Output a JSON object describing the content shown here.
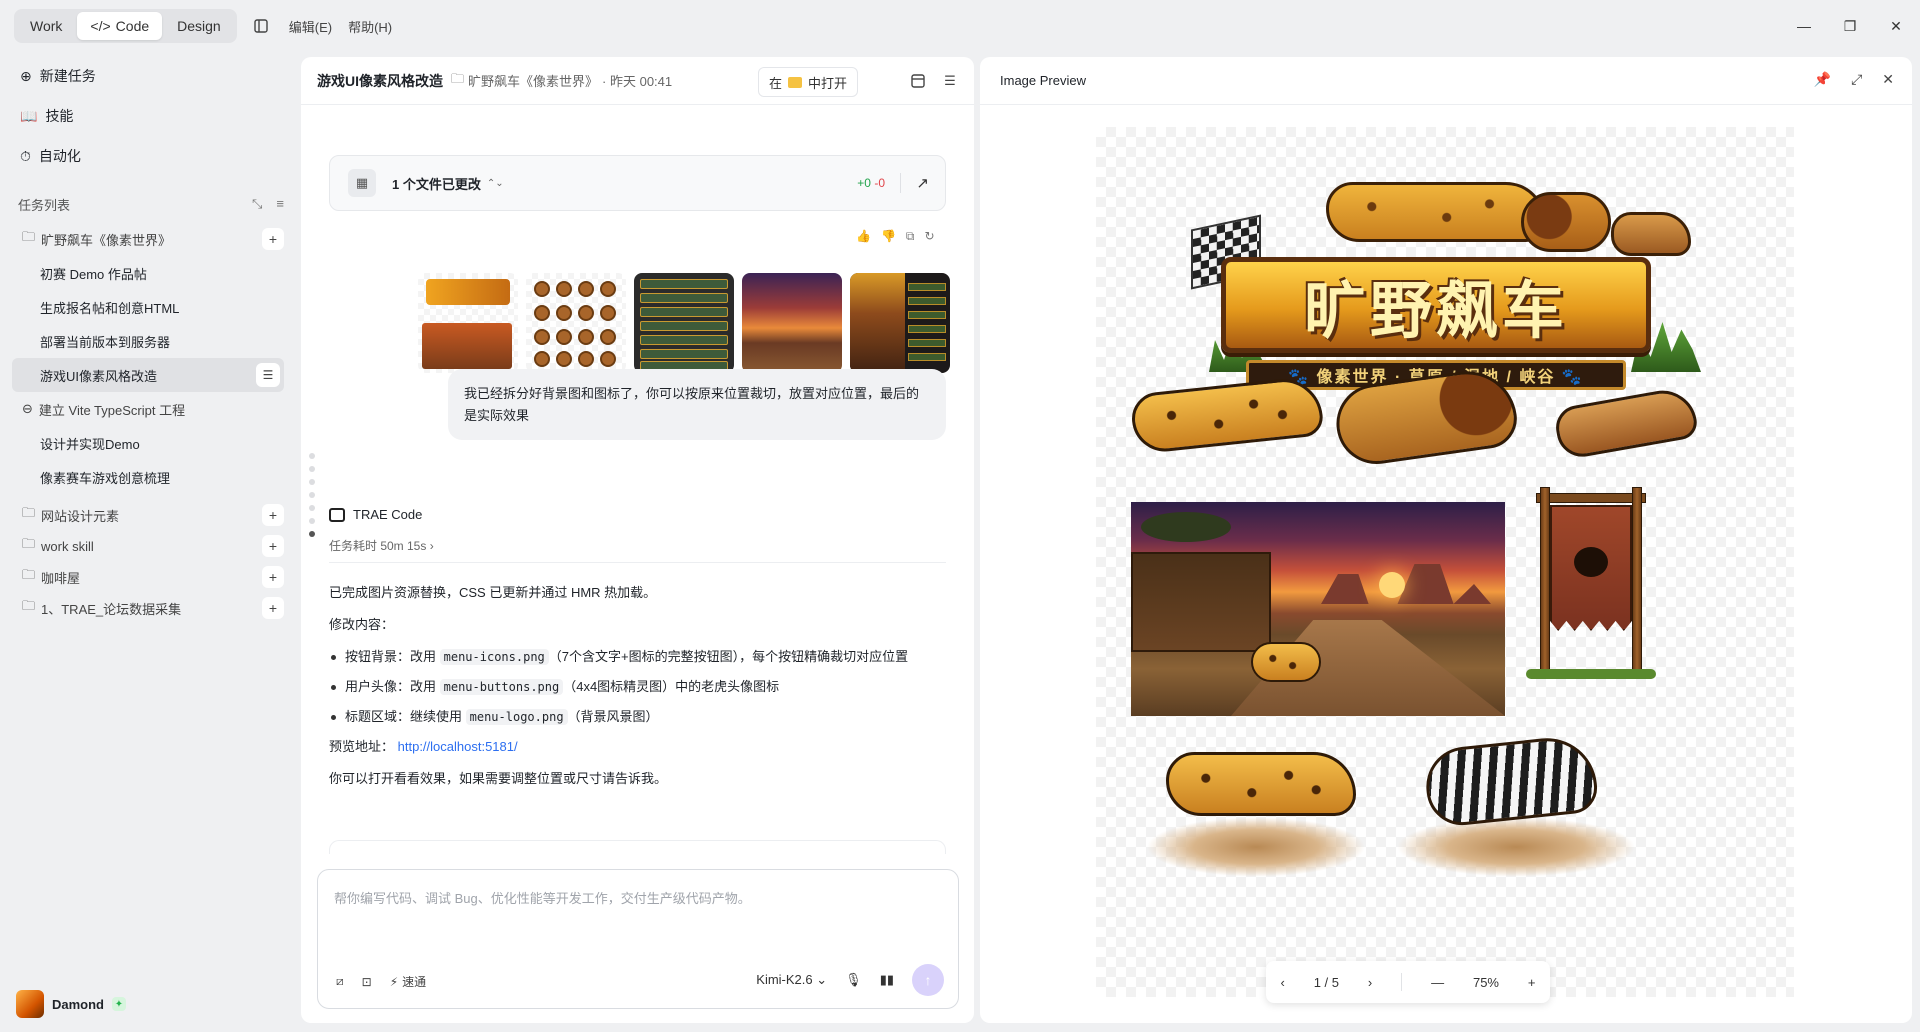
{
  "titlebar": {
    "modes": [
      "Work",
      "Code",
      "Design"
    ],
    "active_mode": "Code",
    "menus": [
      "编辑(E)",
      "帮助(H)"
    ]
  },
  "sidebar": {
    "nav": [
      {
        "label": "新建任务",
        "icon": "plus-circle-icon"
      },
      {
        "label": "技能",
        "icon": "book-icon"
      },
      {
        "label": "自动化",
        "icon": "clock-icon"
      }
    ],
    "task_list_label": "任务列表",
    "groups": [
      {
        "label": "旷野飙车《像素世界》",
        "tasks": [
          "初赛 Demo 作品帖",
          "生成报名帖和创意HTML",
          "部署当前版本到服务器",
          "游戏UI像素风格改造"
        ]
      },
      {
        "label": "建立 Vite TypeScript 工程",
        "tasks": [
          "设计并实现Demo",
          "像素赛车游戏创意梳理"
        ]
      },
      {
        "label": "网站设计元素",
        "tasks": []
      },
      {
        "label": "work skill",
        "tasks": []
      },
      {
        "label": "咖啡屋",
        "tasks": []
      },
      {
        "label": "1、TRAE_论坛数据采集",
        "tasks": []
      }
    ],
    "active_task": "游戏UI像素风格改造",
    "user": {
      "name": "Damond"
    }
  },
  "chat": {
    "title": "游戏UI像素风格改造",
    "project": "旷野飙车《像素世界》",
    "time": "· 昨天 00:41",
    "open_in_prefix": "在",
    "open_in_suffix": "中打开",
    "file_card": {
      "label": "1 个文件已更改",
      "added": "+0",
      "removed": "-0"
    },
    "user_message": "我已经拆分好背景图和图标了，你可以按原来位置裁切，放置对应位置，最后的是实际效果",
    "agent_name": "TRAE Code",
    "duration": "任务耗时 50m 15s",
    "answer": {
      "intro": "已完成图片资源替换，CSS 已更新并通过 HMR 热加载。",
      "changes_label": "修改内容：",
      "items": [
        {
          "prefix": "按钮背景：改用 ",
          "code": "menu-icons.png",
          "suffix": "（7个含文字+图标的完整按钮图），每个按钮精确裁切对应位置"
        },
        {
          "prefix": "用户头像：改用 ",
          "code": "menu-buttons.png",
          "suffix": "（4x4图标精灵图）中的老虎头像图标"
        },
        {
          "prefix": "标题区域：继续使用 ",
          "code": "menu-logo.png",
          "suffix": "（背景风景图）"
        }
      ],
      "preview_label": "预览地址：",
      "preview_url": "http://localhost:5181/",
      "closing": "你可以打开看看效果，如果需要调整位置或尺寸请告诉我。"
    },
    "composer": {
      "placeholder": "帮你编写代码、调试 Bug、优化性能等开发工作，交付生产级代码产物。",
      "speed_label": "速通",
      "model": "Kimi-K2.6"
    }
  },
  "preview": {
    "title": "Image Preview",
    "logo_title": "旷野飙车",
    "logo_subtitle": "🐾 像素世界 · 草原 / 湿地 / 峡谷 🐾",
    "page": "1 / 5",
    "zoom": "75%"
  }
}
